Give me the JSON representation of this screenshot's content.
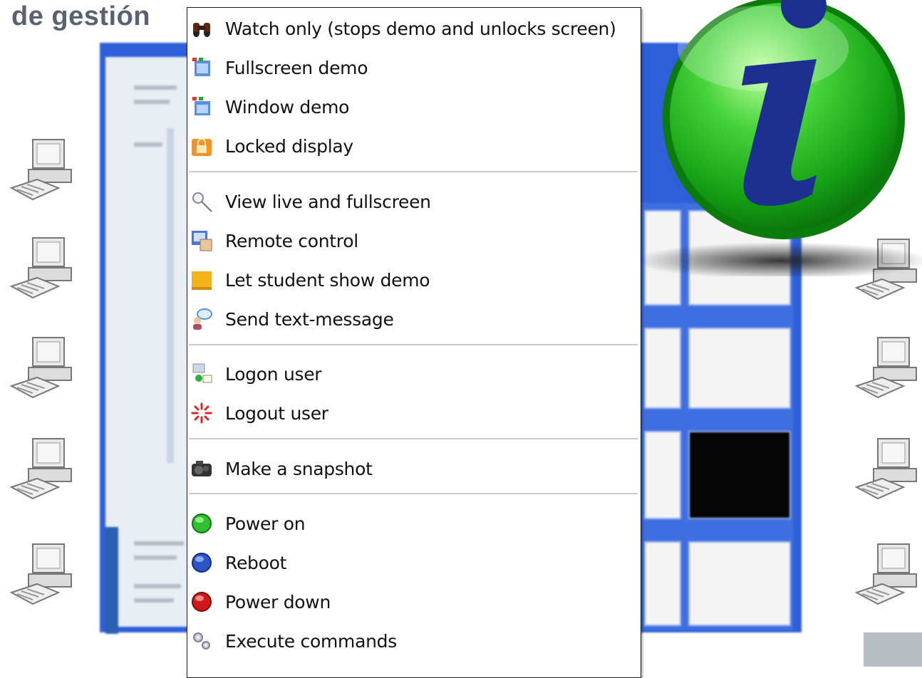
{
  "slide": {
    "title": "de gestión"
  },
  "menu": {
    "items": [
      {
        "label": "Watch only (stops demo and unlocks screen)",
        "icon": "binoculars-icon"
      },
      {
        "label": "Fullscreen demo",
        "icon": "fullscreen-demo-icon"
      },
      {
        "label": "Window demo",
        "icon": "window-demo-icon"
      },
      {
        "label": "Locked display",
        "icon": "lock-icon"
      },
      {
        "label": "View live and fullscreen",
        "icon": "magnifier-icon"
      },
      {
        "label": "Remote control",
        "icon": "remote-control-icon"
      },
      {
        "label": "Let student show demo",
        "icon": "student-demo-icon"
      },
      {
        "label": "Send text-message",
        "icon": "message-icon"
      },
      {
        "label": "Logon user",
        "icon": "logon-user-icon"
      },
      {
        "label": "Logout user",
        "icon": "logout-user-icon"
      },
      {
        "label": "Make a snapshot",
        "icon": "camera-icon"
      },
      {
        "label": "Power on",
        "icon": "power-on-icon"
      },
      {
        "label": "Reboot",
        "icon": "reboot-icon"
      },
      {
        "label": "Power down",
        "icon": "power-down-icon"
      },
      {
        "label": "Execute commands",
        "icon": "gears-icon"
      }
    ]
  },
  "colors": {
    "title": "#5a6270",
    "info_green": "#1fae1f",
    "info_letter": "#1d2f8f",
    "power_on": "#2fbf2f",
    "reboot": "#2c56c8",
    "power_down": "#d01818"
  }
}
